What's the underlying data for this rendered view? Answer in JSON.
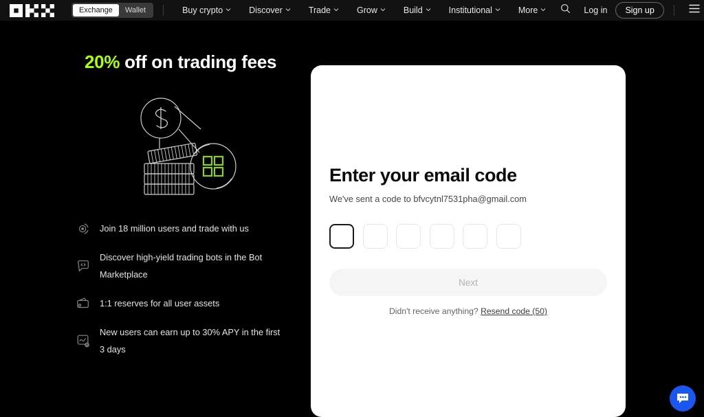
{
  "nav": {
    "logo_name": "okx-logo",
    "segments": [
      {
        "label": "Exchange",
        "active": true
      },
      {
        "label": "Wallet",
        "active": false
      }
    ],
    "links": [
      {
        "label": "Buy crypto",
        "has_chevron": true
      },
      {
        "label": "Discover",
        "has_chevron": true
      },
      {
        "label": "Trade",
        "has_chevron": true
      },
      {
        "label": "Grow",
        "has_chevron": true
      },
      {
        "label": "Build",
        "has_chevron": true
      },
      {
        "label": "Institutional",
        "has_chevron": true
      },
      {
        "label": "More",
        "has_chevron": true
      }
    ],
    "search_icon": "search-icon",
    "login_label": "Log in",
    "signup_label": "Sign up",
    "menu_icon": "hamburger-menu-icon"
  },
  "promo": {
    "title_highlight": "20%",
    "title_rest": " off on trading fees",
    "highlight_color": "#aaff00",
    "illustration_name": "coins-and-badge-illustration",
    "features": [
      {
        "icon": "community-users-icon",
        "text": "Join 18 million users and trade with us"
      },
      {
        "icon": "trading-bot-icon",
        "text": "Discover high-yield trading bots in the Bot Marketplace"
      },
      {
        "icon": "wallet-reserves-icon",
        "text": "1:1 reserves for all user assets"
      },
      {
        "icon": "earn-chart-star-icon",
        "text": "New users can earn up to 30% APY in the first 3 days"
      }
    ]
  },
  "card": {
    "title": "Enter your email code",
    "subtitle": "We've sent a code to bfvcytnl7531pha@gmail.com",
    "otp": {
      "length": 6,
      "values": [
        "",
        "",
        "",
        "",
        "",
        ""
      ],
      "focused_index": 0
    },
    "next_label": "Next",
    "resend_prefix": "Didn't receive anything?",
    "resend_link": "Resend code (50)"
  },
  "chat": {
    "icon": "chat-bubble-icon",
    "color": "#1a56f0"
  }
}
